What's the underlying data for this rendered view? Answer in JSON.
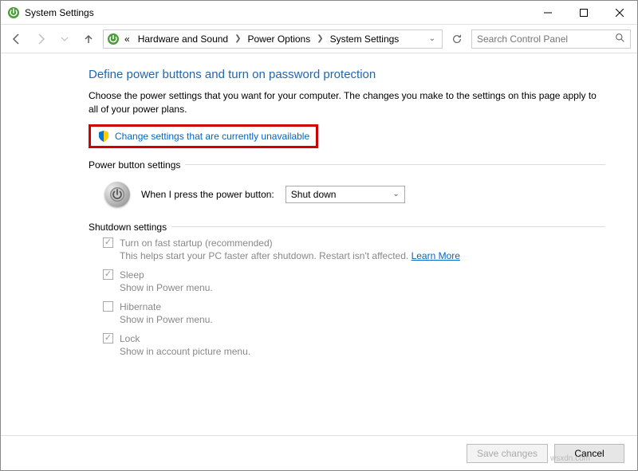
{
  "window": {
    "title": "System Settings"
  },
  "nav": {
    "crumb_prefix": "«",
    "crumb1": "Hardware and Sound",
    "crumb2": "Power Options",
    "crumb3": "System Settings",
    "search_placeholder": "Search Control Panel"
  },
  "page": {
    "heading": "Define power buttons and turn on password protection",
    "subtext": "Choose the power settings that you want for your computer. The changes you make to the settings on this page apply to all of your power plans.",
    "change_link": "Change settings that are currently unavailable"
  },
  "powerbtn": {
    "section": "Power button settings",
    "label": "When I press the power button:",
    "selected": "Shut down"
  },
  "shutdown": {
    "section": "Shutdown settings",
    "items": [
      {
        "title": "Turn on fast startup (recommended)",
        "desc_pre": "This helps start your PC faster after shutdown. Restart isn't affected. ",
        "link": "Learn More",
        "checked": true
      },
      {
        "title": "Sleep",
        "desc": "Show in Power menu.",
        "checked": true
      },
      {
        "title": "Hibernate",
        "desc": "Show in Power menu.",
        "checked": false
      },
      {
        "title": "Lock",
        "desc": "Show in account picture menu.",
        "checked": true
      }
    ]
  },
  "footer": {
    "save": "Save changes",
    "cancel": "Cancel"
  },
  "watermark": "wsxdn.com"
}
